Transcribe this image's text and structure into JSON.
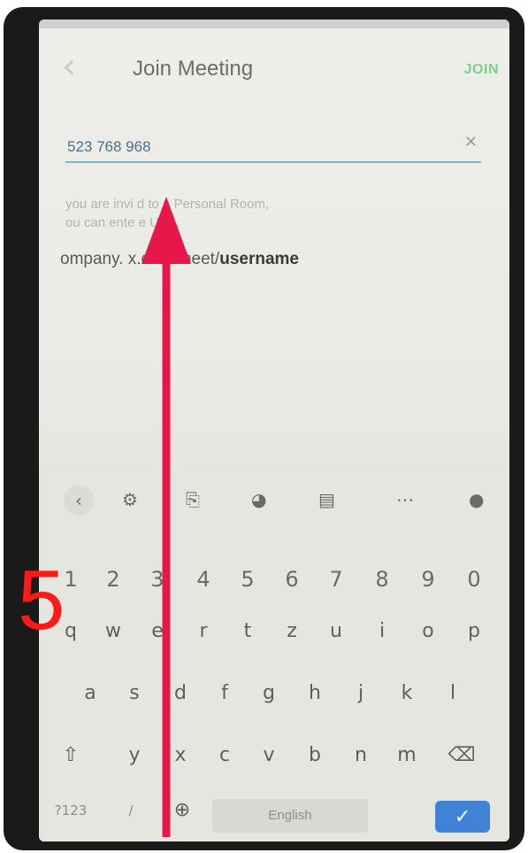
{
  "app_bar": {
    "title": "Join Meeting",
    "join_label": "JOIN",
    "back_icon": "chevron-left-icon"
  },
  "meeting_input": {
    "value": "523 768 968",
    "clear_icon": "close-icon"
  },
  "hint": {
    "line1": "you are invi  d to a Personal Room,",
    "line2": "ou can ente    e URL.",
    "url_prefix": "ompany.      x.com/meet/",
    "url_bold": "username"
  },
  "keyboard": {
    "toolbar_icons": [
      "chevron-left-icon",
      "gear-icon",
      "translate-icon",
      "palette-icon",
      "clipboard-icon",
      "more-icon",
      "mic-icon"
    ],
    "number_row": [
      "1",
      "2",
      "3",
      "4",
      "5",
      "6",
      "7",
      "8",
      "9",
      "0"
    ],
    "row1": [
      "q",
      "w",
      "e",
      "r",
      "t",
      "z",
      "u",
      "i",
      "o",
      "p"
    ],
    "row2": [
      "a",
      "s",
      "d",
      "f",
      "g",
      "h",
      "j",
      "k",
      "l"
    ],
    "row3": [
      "y",
      "x",
      "c",
      "v",
      "b",
      "n",
      "m"
    ],
    "symbols_label": "?123",
    "slash_label": "/",
    "space_label": "English"
  },
  "annotation": {
    "step_number": "5",
    "color": "#ff1a1a",
    "arrow_color": "#e8174a"
  }
}
